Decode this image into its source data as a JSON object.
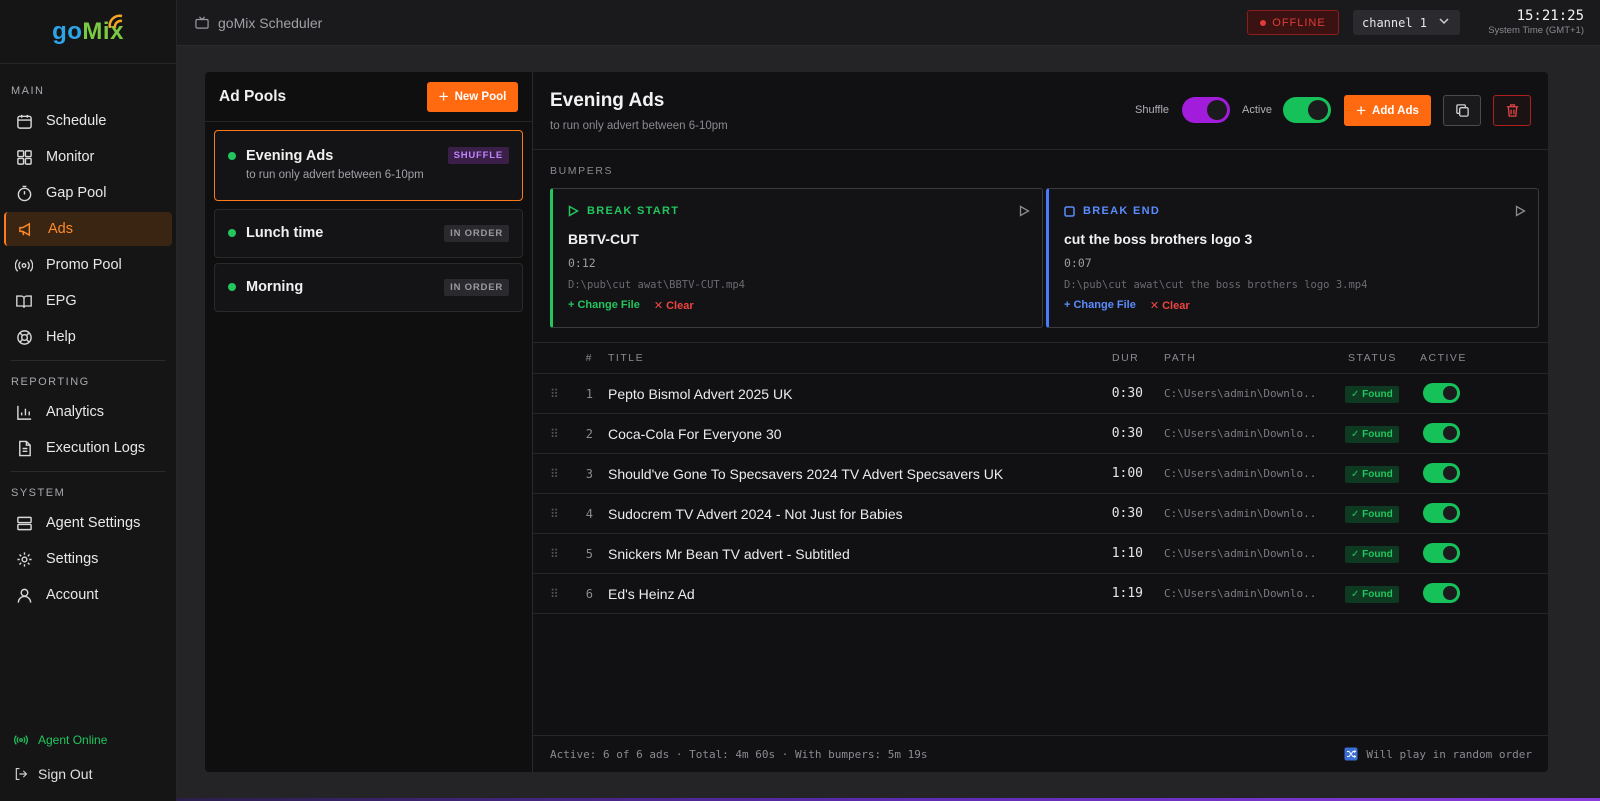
{
  "brand": {
    "name_part1": "go",
    "name_part2": "Mix"
  },
  "sidebar": {
    "sections": [
      {
        "label": "MAIN",
        "items": [
          {
            "label": "Schedule",
            "icon": "calendar-icon"
          },
          {
            "label": "Monitor",
            "icon": "grid-icon"
          },
          {
            "label": "Gap Pool",
            "icon": "timer-icon"
          },
          {
            "label": "Ads",
            "icon": "megaphone-icon",
            "active": true
          },
          {
            "label": "Promo Pool",
            "icon": "broadcast-icon"
          },
          {
            "label": "EPG",
            "icon": "book-icon"
          },
          {
            "label": "Help",
            "icon": "lifebuoy-icon"
          }
        ]
      },
      {
        "label": "REPORTING",
        "items": [
          {
            "label": "Analytics",
            "icon": "bar-chart-icon"
          },
          {
            "label": "Execution Logs",
            "icon": "document-icon"
          }
        ]
      },
      {
        "label": "SYSTEM",
        "items": [
          {
            "label": "Agent Settings",
            "icon": "server-icon"
          },
          {
            "label": "Settings",
            "icon": "gear-icon"
          },
          {
            "label": "Account",
            "icon": "user-icon"
          }
        ]
      }
    ],
    "agent_status": "Agent Online",
    "sign_out": "Sign Out"
  },
  "topbar": {
    "title": "goMix Scheduler",
    "status": "OFFLINE",
    "channel": "channel 1",
    "time": "15:21:25",
    "timezone": "System Time (GMT+1)"
  },
  "pools": {
    "title": "Ad Pools",
    "new_button": "New Pool",
    "items": [
      {
        "name": "Evening Ads",
        "description": "to run only advert between 6-10pm",
        "mode": "SHUFFLE",
        "selected": true
      },
      {
        "name": "Lunch time",
        "description": "",
        "mode": "IN ORDER"
      },
      {
        "name": "Morning",
        "description": "",
        "mode": "IN ORDER"
      }
    ]
  },
  "detail": {
    "title": "Evening Ads",
    "subtitle": "to run only advert between 6-10pm",
    "shuffle_label": "Shuffle",
    "active_label": "Active",
    "add_button": "Add Ads",
    "bumpers_label": "BUMPERS",
    "bumpers": {
      "start": {
        "label": "BREAK START",
        "name": "BBTV-CUT",
        "duration": "0:12",
        "path": "D:\\pub\\cut awat\\BBTV-CUT.mp4",
        "change": "+ Change File",
        "clear": "✕ Clear"
      },
      "end": {
        "label": "BREAK END",
        "name": "cut the boss brothers logo 3",
        "duration": "0:07",
        "path": "D:\\pub\\cut awat\\cut the boss brothers logo 3.mp4",
        "change": "+ Change File",
        "clear": "✕ Clear"
      }
    },
    "table": {
      "headers": {
        "num": "#",
        "title": "TITLE",
        "dur": "DUR",
        "path": "PATH",
        "status": "STATUS",
        "active": "ACTIVE"
      },
      "rows": [
        {
          "num": "1",
          "title": "Pepto Bismol Advert 2025 UK",
          "dur": "0:30",
          "path": "C:\\Users\\admin\\Downlo...",
          "status": "✓ Found"
        },
        {
          "num": "2",
          "title": "Coca-Cola For Everyone 30",
          "dur": "0:30",
          "path": "C:\\Users\\admin\\Downlo...",
          "status": "✓ Found"
        },
        {
          "num": "3",
          "title": "Should've Gone To Specsavers 2024 TV Advert Specsavers UK",
          "dur": "1:00",
          "path": "C:\\Users\\admin\\Downlo...",
          "status": "✓ Found"
        },
        {
          "num": "4",
          "title": "Sudocrem TV Advert 2024 - Not Just for Babies",
          "dur": "0:30",
          "path": "C:\\Users\\admin\\Downlo...",
          "status": "✓ Found"
        },
        {
          "num": "5",
          "title": "Snickers Mr Bean TV advert - Subtitled",
          "dur": "1:10",
          "path": "C:\\Users\\admin\\Downlo...",
          "status": "✓ Found"
        },
        {
          "num": "6",
          "title": "Ed's Heinz Ad",
          "dur": "1:19",
          "path": "C:\\Users\\admin\\Downlo...",
          "status": "✓ Found"
        }
      ]
    },
    "footer": {
      "summary": "Active: 6 of 6 ads · Total: 4m 60s · With bumpers: 5m 19s",
      "order_note": "Will play in random order"
    }
  },
  "colors": {
    "accent": "#ff6a10",
    "online": "#22c55e",
    "offline": "#e03b3b",
    "shuffle": "#a21cdc",
    "break_end": "#4a7bff"
  }
}
